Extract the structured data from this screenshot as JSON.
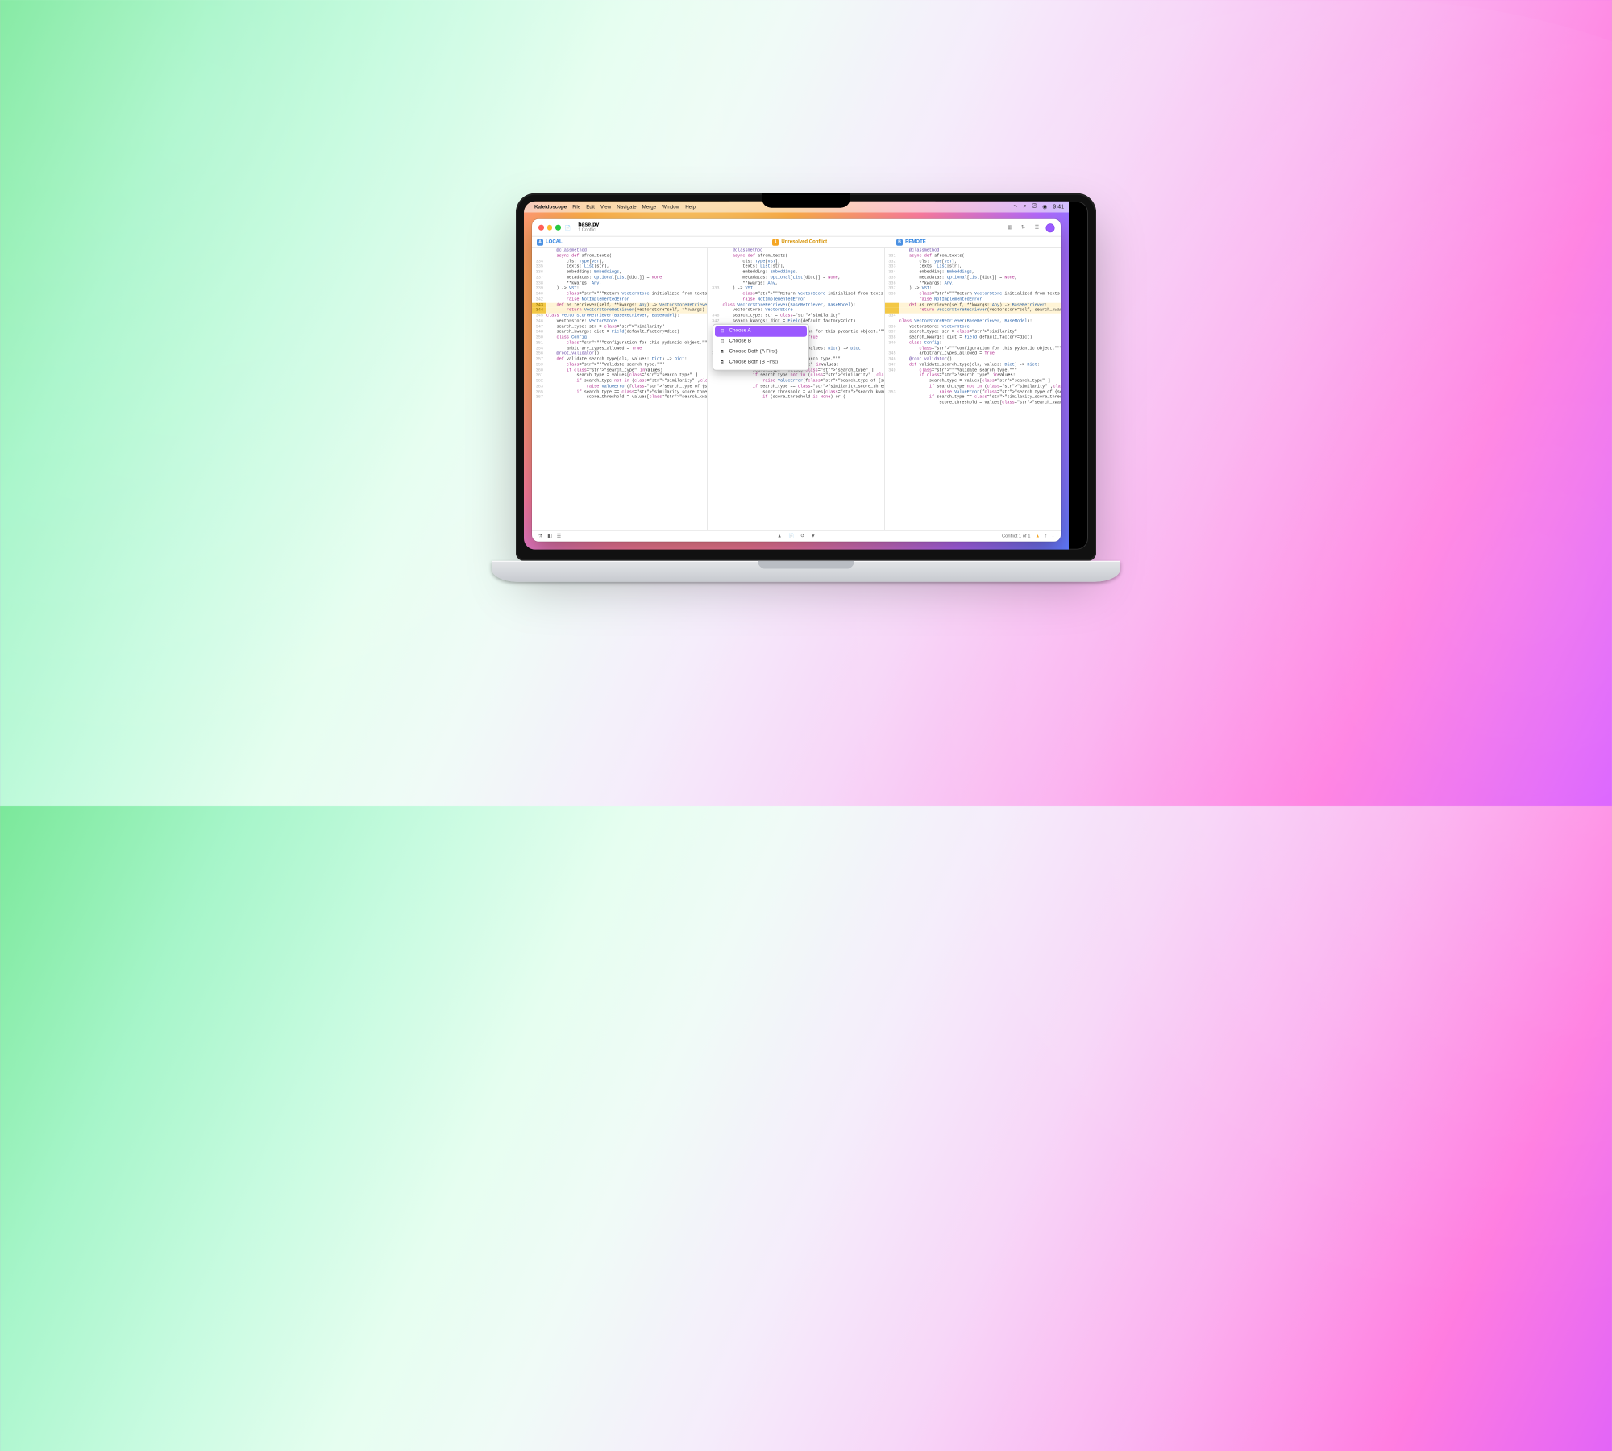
{
  "menubar": {
    "app": "Kaleidoscope",
    "items": [
      "File",
      "Edit",
      "View",
      "Navigate",
      "Merge",
      "Window",
      "Help"
    ],
    "clock": "9:41"
  },
  "window": {
    "filename": "base.py",
    "subtitle": "1 Conflict"
  },
  "panes": {
    "local_label": "LOCAL",
    "center_label": "Unresolved Conflict",
    "remote_label": "REMOTE",
    "local_badge": "A",
    "remote_badge": "B",
    "center_badge": "1"
  },
  "context_menu": {
    "choose_a": "Choose A",
    "choose_b": "Choose B",
    "choose_both_a": "Choose Both (A First)",
    "choose_both_b": "Choose Both (B First)"
  },
  "status": {
    "conflict": "Conflict 1 of 1"
  },
  "code": {
    "left": [
      {
        "n": "",
        "t": "    @classmethod"
      },
      {
        "n": "",
        "t": "    async def afrom_texts("
      },
      {
        "n": "334",
        "t": "        cls: Type[VST],"
      },
      {
        "n": "335",
        "t": "        texts: List[str],"
      },
      {
        "n": "336",
        "t": "        embedding: Embeddings,"
      },
      {
        "n": "337",
        "t": "        metadatas: Optional[List[dict]] = None,"
      },
      {
        "n": "338",
        "t": "        **kwargs: Any,"
      },
      {
        "n": "339",
        "t": "    ) -> VST:"
      },
      {
        "n": "340",
        "t": "        \"\"\"Return VectorStore initialized from texts and embeddings.\"\"\""
      },
      {
        "n": "342",
        "t": "        raise NotImplementedError"
      },
      {
        "n": "343",
        "t": "    def as_retriever(self, **kwargs: Any) -> VectorStoreRetriever:",
        "hl": 1
      },
      {
        "n": "344",
        "t": "        return VectorStoreRetriever(vectorstore=self, **kwargs)",
        "hl": 1
      },
      {
        "n": "",
        "t": ""
      },
      {
        "n": "",
        "t": ""
      },
      {
        "n": "345",
        "t": "class VectorStoreRetriever(BaseRetriever, BaseModel):"
      },
      {
        "n": "346",
        "t": "    vectorstore: VectorStore"
      },
      {
        "n": "347",
        "t": "    search_type: str = \"similarity\""
      },
      {
        "n": "348",
        "t": "    search_kwargs: dict = Field(default_factory=dict)"
      },
      {
        "n": "",
        "t": ""
      },
      {
        "n": "350",
        "t": "    class Config:"
      },
      {
        "n": "351",
        "t": "        \"\"\"Configuration for this pydantic object.\"\"\""
      },
      {
        "n": "",
        "t": ""
      },
      {
        "n": "354",
        "t": "        arbitrary_types_allowed = True"
      },
      {
        "n": "",
        "t": ""
      },
      {
        "n": "356",
        "t": "    @root_validator()"
      },
      {
        "n": "357",
        "t": "    def validate_search_type(cls, values: Dict) -> Dict:"
      },
      {
        "n": "",
        "t": ""
      },
      {
        "n": "359",
        "t": "        \"\"\"Validate search type.\"\"\""
      },
      {
        "n": "360",
        "t": "        if \"search_type\" in values:"
      },
      {
        "n": "361",
        "t": "            search_type = values[\"search_type\"]"
      },
      {
        "n": "362",
        "t": "            if search_type not in (\"similarity\", \"similarity_score_threshold\", \"mmr\"):"
      },
      {
        "n": "363",
        "t": "                raise ValueError(f\"search_type of {search_type} not allowed.\")"
      },
      {
        "n": "365",
        "t": "            if search_type == \"similarity_score_threshold\":"
      },
      {
        "n": "367",
        "t": "                score_threshold = values[\"search_kwargs\"].get(\"score_threshold\")"
      }
    ],
    "center": [
      {
        "n": "",
        "t": "    @classmethod"
      },
      {
        "n": "",
        "t": "    async def afrom_texts("
      },
      {
        "n": "",
        "t": "        cls: Type[VST],"
      },
      {
        "n": "",
        "t": "        texts: List[str],"
      },
      {
        "n": "",
        "t": "        embedding: Embeddings,"
      },
      {
        "n": "",
        "t": "        metadatas: Optional[List[dict]] = None,"
      },
      {
        "n": "",
        "t": "        **kwargs: Any,"
      },
      {
        "n": "333",
        "t": "    ) -> VST:"
      },
      {
        "n": "",
        "t": "        \"\"\"Return VectorStore initialized from texts and embeddings.\"\"\""
      },
      {
        "n": "",
        "t": "        raise NotImplementedError"
      },
      {
        "n": "",
        "t": "",
        "hl": 2
      },
      {
        "n": "",
        "t": "",
        "hl": 2
      },
      {
        "n": "",
        "t": ""
      },
      {
        "n": "",
        "t": ""
      },
      {
        "n": "",
        "t": "class VectorStoreRetriever(BaseRetriever, BaseModel):"
      },
      {
        "n": "",
        "t": "    vectorstore: VectorStore"
      },
      {
        "n": "346",
        "t": "    search_type: str = \"similarity\""
      },
      {
        "n": "347",
        "t": "    search_kwargs: dict = Field(default_factory=dict)"
      },
      {
        "n": "",
        "t": ""
      },
      {
        "n": "",
        "t": "    class Config:"
      },
      {
        "n": "",
        "t": "        \"\"\"Configuration for this pydantic object.\"\"\""
      },
      {
        "n": "",
        "t": ""
      },
      {
        "n": "",
        "t": "        arbitrary_types_allowed = True"
      },
      {
        "n": "",
        "t": ""
      },
      {
        "n": "",
        "t": "    @root_validator()"
      },
      {
        "n": "",
        "t": "    def validate_search_type(cls, values: Dict) -> Dict:"
      },
      {
        "n": "359",
        "t": ""
      },
      {
        "n": "",
        "t": "        \"\"\"Validate search type.\"\"\""
      },
      {
        "n": "",
        "t": "        if \"search_type\" in values:"
      },
      {
        "n": "",
        "t": "            search_type = values[\"search_type\"]"
      },
      {
        "n": "",
        "t": "            if search_type not in (\"similarity\", \"similarity_score_threshold\", \"mmr\"):"
      },
      {
        "n": "",
        "t": "                raise ValueError(f\"search_type of {search_type} not allowed.\")"
      },
      {
        "n": "",
        "t": "            if search_type == \"similarity_score_threshold\":"
      },
      {
        "n": "",
        "t": "                score_threshold = values[\"search_kwargs\"].get(\"score_threshold\")"
      },
      {
        "n": "",
        "t": "                if (score_threshold is None) or ("
      }
    ],
    "right": [
      {
        "n": "",
        "t": "    @classmethod"
      },
      {
        "n": "331",
        "t": "    async def afrom_texts("
      },
      {
        "n": "332",
        "t": "        cls: Type[VST],"
      },
      {
        "n": "333",
        "t": "        texts: List[str],"
      },
      {
        "n": "334",
        "t": "        embedding: Embeddings,"
      },
      {
        "n": "335",
        "t": "        metadatas: Optional[List[dict]] = None,"
      },
      {
        "n": "336",
        "t": "        **kwargs: Any,"
      },
      {
        "n": "337",
        "t": "    ) -> VST:"
      },
      {
        "n": "338",
        "t": "        \"\"\"Return VectorStore initialized from texts and embeddings.\"\"\""
      },
      {
        "n": "",
        "t": "        raise NotImplementedError"
      },
      {
        "n": "",
        "t": "    def as_retriever(self, **kwargs: Any) -> BaseRetriever:",
        "hl": 1
      },
      {
        "n": "",
        "t": "        return VectorStoreRetriever(vectorstore=self, search_kwargs=kwargs)",
        "hl": 1
      },
      {
        "n": "",
        "t": ""
      },
      {
        "n": "334",
        "t": ""
      },
      {
        "n": "",
        "t": "class VectorStoreRetriever(BaseRetriever, BaseModel):"
      },
      {
        "n": "336",
        "t": "    vectorstore: VectorStore"
      },
      {
        "n": "337",
        "t": "    search_type: str = \"similarity\""
      },
      {
        "n": "338",
        "t": "    search_kwargs: dict = Field(default_factory=dict)"
      },
      {
        "n": "",
        "t": ""
      },
      {
        "n": "340",
        "t": "    class Config:"
      },
      {
        "n": "",
        "t": "        \"\"\"Configuration for this pydantic object.\"\"\""
      },
      {
        "n": "",
        "t": ""
      },
      {
        "n": "345",
        "t": "        arbitrary_types_allowed = True"
      },
      {
        "n": "",
        "t": ""
      },
      {
        "n": "346",
        "t": "    @root_validator()"
      },
      {
        "n": "347",
        "t": "    def validate_search_type(cls, values: Dict) -> Dict:"
      },
      {
        "n": "",
        "t": ""
      },
      {
        "n": "349",
        "t": "        \"\"\"Validate search type.\"\"\""
      },
      {
        "n": "",
        "t": "        if \"search_type\" in values:"
      },
      {
        "n": "",
        "t": "            search_type = values[\"search_type\"]"
      },
      {
        "n": "",
        "t": "            if search_type not in (\"similarity\", \"similarity_score_threshold\", \"mmr\"):"
      },
      {
        "n": "353",
        "t": "                raise ValueError(f\"search_type of {search_type} not allowed.\")"
      },
      {
        "n": "",
        "t": "            if search_type == \"similarity_score_threshold\":"
      },
      {
        "n": "",
        "t": "                score_threshold = values[\"search_kwargs\"].get(\"score_threshold\")"
      }
    ]
  }
}
